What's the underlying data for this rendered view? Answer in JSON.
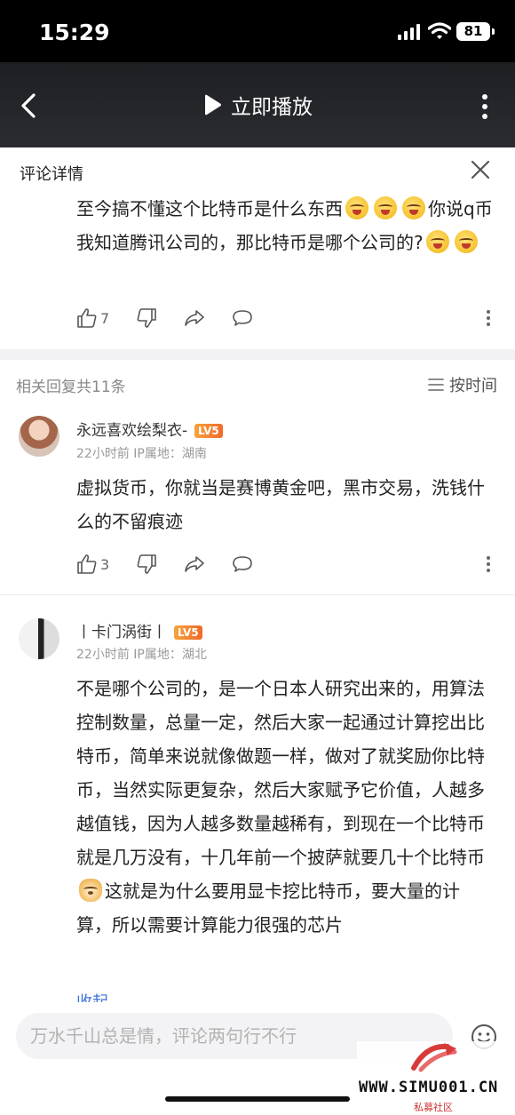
{
  "status_bar": {
    "time": "15:29",
    "battery": "81"
  },
  "header": {
    "play_label": "立即播放"
  },
  "panel": {
    "title": "评论详情"
  },
  "main_comment": {
    "text_1": "至今搞不懂这个比特币是什么东西",
    "text_2": "你说q币我知道腾讯公司的，那比特币是哪个公司的?",
    "like_count": "7"
  },
  "replies_header": {
    "count_label": "相关回复共11条",
    "sort_label": "按时间"
  },
  "replies": [
    {
      "username": "永远喜欢绘梨衣-",
      "level": "LV5",
      "meta": "22小时前  IP属地：湖南",
      "text": "虚拟货币，你就当是赛博黄金吧，黑市交易，洗钱什么的不留痕迹",
      "like_count": "3"
    },
    {
      "username": "丨卡门涡街丨",
      "level": "LV5",
      "meta": "22小时前  IP属地：湖北",
      "text_1": "不是哪个公司的，是一个日本人研究出来的，用算法控制数量，总量一定，然后大家一起通过计算挖出比特币，简单来说就像做题一样，做对了就奖励你比特币，当然实际更复杂，然后大家赋予它价值，人越多越值钱，因为人越多数量越稀有，到现在一个比特币就是几万没有，十几年前一个披萨就要几十个比特币",
      "text_2": "这就是为什么要用显卡挖比特币，要大量的计算，所以需要计算能力很强的芯片",
      "collapse_label": "收起"
    }
  ],
  "input": {
    "placeholder": "万水千山总是情，评论两句行不行"
  },
  "watermark": {
    "site": "WWW.SIMU001.CN",
    "sub": "私募社区"
  },
  "icons": {
    "back": "chevron-left-icon",
    "play": "play-icon",
    "more": "more-vert-icon",
    "close": "close-icon",
    "like": "thumbs-up-icon",
    "dislike": "thumbs-down-icon",
    "share": "share-icon",
    "comment": "comment-bubble-icon",
    "sort": "sort-lines-icon",
    "emoji": "emoji-icon"
  }
}
